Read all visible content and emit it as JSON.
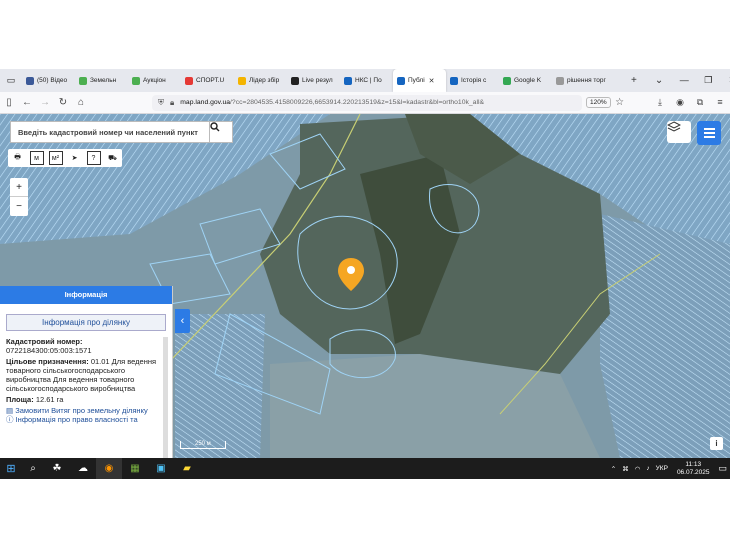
{
  "browser": {
    "tabs": [
      {
        "label": "(50) Відео",
        "icon": "facebook-icon",
        "color": "#3b5998"
      },
      {
        "label": "Земельн",
        "icon": "puzzle-icon",
        "color": "#4caf50"
      },
      {
        "label": "Аукціон",
        "icon": "puzzle-icon",
        "color": "#4caf50"
      },
      {
        "label": "СПОРТ.U",
        "icon": "sport-icon",
        "color": "#e53935"
      },
      {
        "label": "Лідер збір",
        "icon": "leader-icon",
        "color": "#f4b400"
      },
      {
        "label": "Live резул",
        "icon": "live-icon",
        "color": "#222222"
      },
      {
        "label": "НКС | По",
        "icon": "flag-icon",
        "color": "#1565c0"
      },
      {
        "label": "Публі",
        "icon": "flag-ua-icon",
        "color": "#1565c0",
        "active": true
      },
      {
        "label": "Історія с",
        "icon": "history-icon",
        "color": "#1565c0"
      },
      {
        "label": "Google K",
        "icon": "maps-icon",
        "color": "#34a853"
      },
      {
        "label": "рішення торг",
        "icon": "doc-icon",
        "color": "#999999"
      }
    ],
    "new_tab": "+",
    "tab_list": "⌄",
    "url_domain": "map.land.gov.ua",
    "url_rest": "/?cc=2804535.4158009226,6653914.220213519&z=15&l=kadastr&bl=ortho10k_all&",
    "zoom": "120%"
  },
  "map": {
    "search_placeholder": "Введіть кадастровий номер чи населений пункт",
    "zoom_in": "+",
    "zoom_out": "−",
    "scale_label": "250 м",
    "info_button": "i",
    "collapse_arrow": "‹"
  },
  "panel": {
    "header": "Інформація",
    "subheader": "Інформація про ділянку",
    "cadastral_label": "Кадастровий номер:",
    "cadastral_value": "0722184300:05:003:1571",
    "purpose_label": "Цільове призначення:",
    "purpose_value": "01.01 Для ведення товарного сільськогосподарського виробництва Для ведення товарного сільськогосподарського виробництва",
    "area_label": "Площа:",
    "area_value": "12.61 га",
    "link1": "Замовити Витяг про земельну ділянку",
    "link2": "Інформація про право власності та"
  },
  "taskbar": {
    "lang": "УКР",
    "time": "11:13",
    "date": "06.07.2025"
  },
  "colors": {
    "accent": "#2c7be5",
    "marker": "#f5a623",
    "parcel_outline": "#9fd3f5"
  }
}
